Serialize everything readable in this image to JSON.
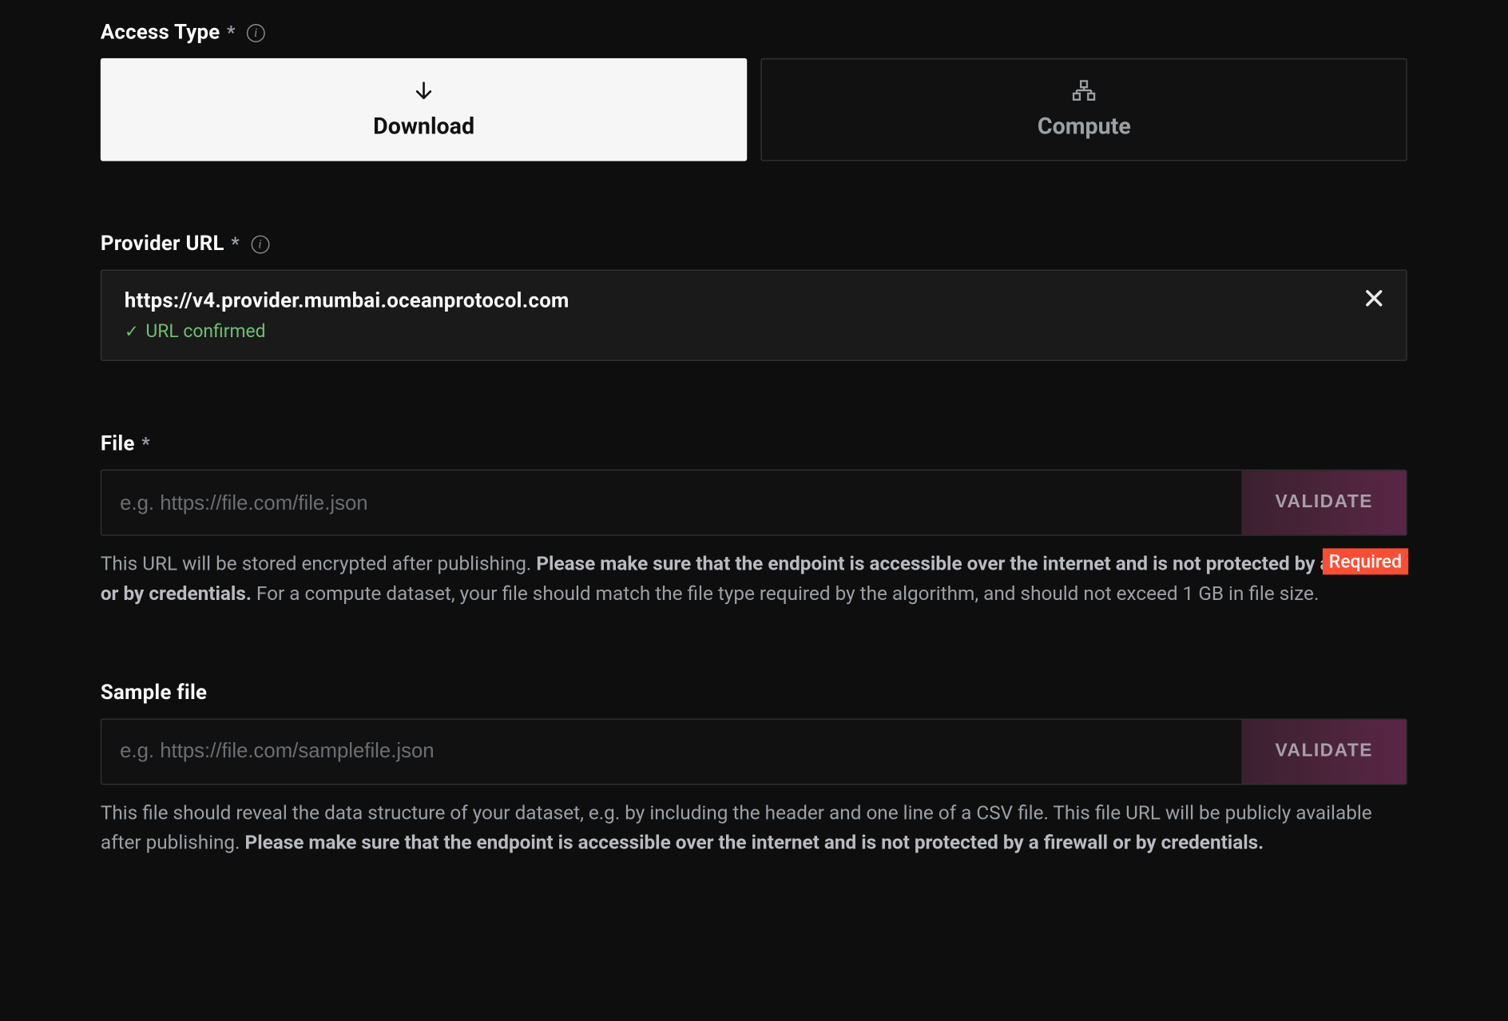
{
  "access_type": {
    "label": "Access Type",
    "download_label": "Download",
    "compute_label": "Compute"
  },
  "provider": {
    "label": "Provider URL",
    "url": "https://v4.provider.mumbai.oceanprotocol.com",
    "confirmed_text": "URL confirmed"
  },
  "file": {
    "label": "File",
    "placeholder": "e.g. https://file.com/file.json",
    "validate_label": "VALIDATE",
    "required_badge": "Required",
    "help_pre": "This URL will be stored encrypted after publishing. ",
    "help_bold": "Please make sure that the endpoint is accessible over the internet and is not protected by a firewall or by credentials.",
    "help_post": " For a compute dataset, your file should match the file type required by the algorithm, and should not exceed 1 GB in file size."
  },
  "sample": {
    "label": "Sample file",
    "placeholder": "e.g. https://file.com/samplefile.json",
    "validate_label": "VALIDATE",
    "help_pre": "This file should reveal the data structure of your dataset, e.g. by including the header and one line of a CSV file. This file URL will be publicly available after publishing. ",
    "help_bold": "Please make sure that the endpoint is accessible over the internet and is not protected by a firewall or by credentials."
  }
}
